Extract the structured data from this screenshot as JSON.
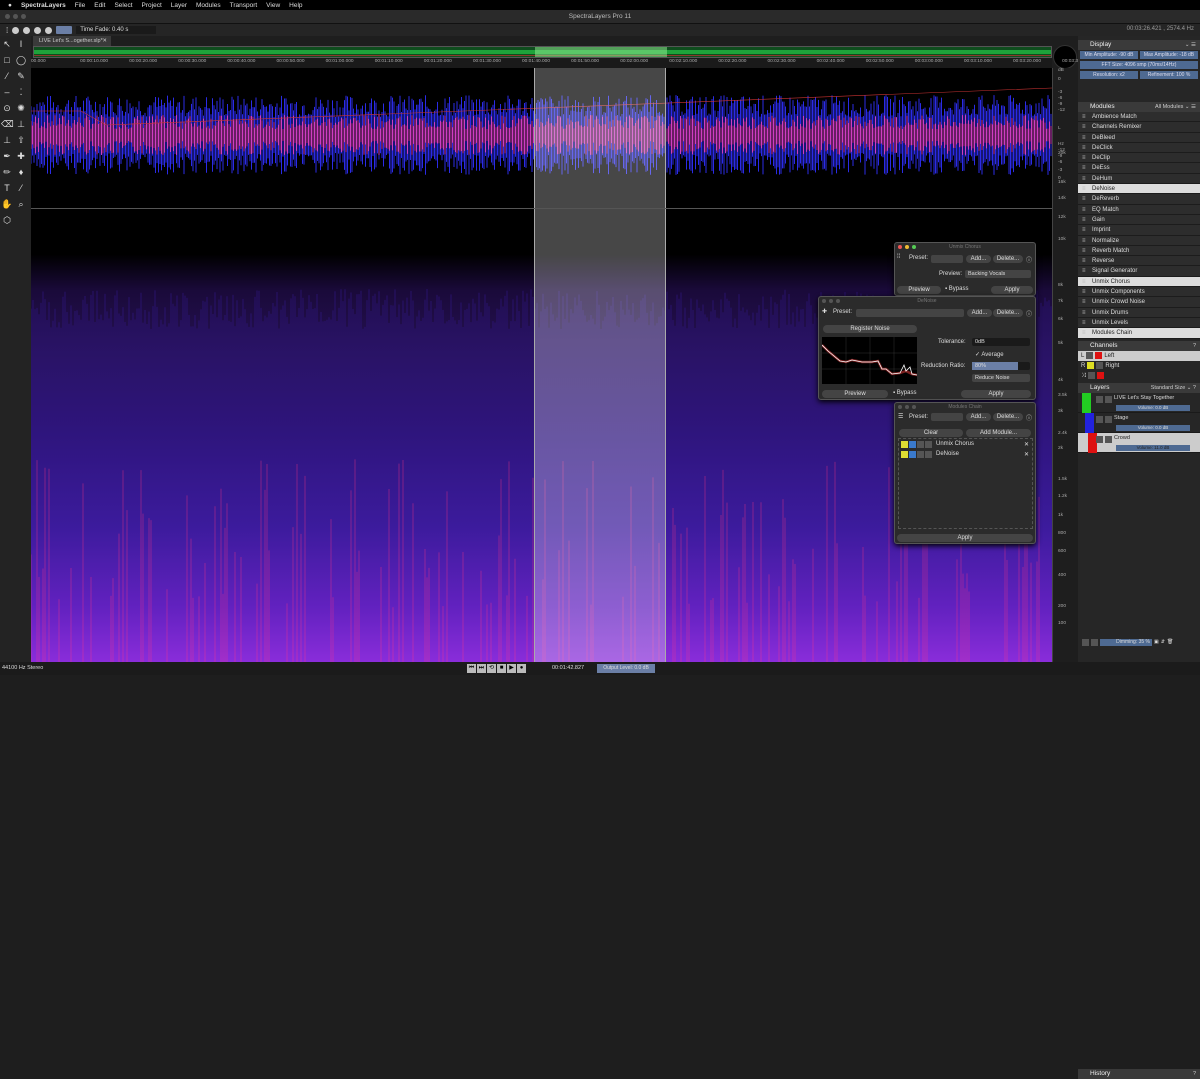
{
  "menubar": {
    "app": "SpectraLayers",
    "items": [
      "File",
      "Edit",
      "Select",
      "Project",
      "Layer",
      "Modules",
      "Transport",
      "View",
      "Help"
    ]
  },
  "window": {
    "title": "SpectraLayers Pro 11"
  },
  "toolbar": {
    "time_fade": "Time Fade: 0.40 s",
    "cursor_info": "00:03:26.421 , 2574.4 Hz"
  },
  "tab": {
    "label": "LIVE Let's S...ogether.slp*",
    "close": "✕"
  },
  "ruler": [
    "00.000",
    "00:00:10.000",
    "00:00:20.000",
    "00:00:30.000",
    "00:00:40.000",
    "00:00:50.000",
    "00:01:00.000",
    "00:01:10.000",
    "00:01:20.000",
    "00:01:30.000",
    "00:01:40.000",
    "00:01:50.000",
    "00:02:00.000",
    "00:02:10.000",
    "00:02:20.000",
    "00:02:30.000",
    "00:02:40.000",
    "00:02:50.000",
    "00:03:00.000",
    "00:03:10.000",
    "00:03:20.000",
    "00:03:30.000"
  ],
  "amp_axis": [
    "dB",
    "0",
    "-3",
    "-6",
    "-9",
    "-12",
    "L",
    "-12",
    "-9",
    "-6",
    "-3",
    "0"
  ],
  "freq_axis": [
    "Hz",
    "20k",
    "16k",
    "14k",
    "12k",
    "10k",
    "8k",
    "7k",
    "6k",
    "5k",
    "4k",
    "3.5k",
    "3k",
    "2.4k",
    "2k",
    "1.5k",
    "1.2k",
    "1k",
    "800",
    "600",
    "400",
    "200",
    "100"
  ],
  "selection": {
    "start": "00:01:42.827"
  },
  "display": {
    "title": "Display",
    "min_amp": "Min Amplitude: -90 dB",
    "max_amp": "Max Amplitude: -18 dB",
    "fft": "FFT Size: 4096 smp (70ms/14Hz)",
    "resolution": "Resolution: x2",
    "refinement": "Refinement: 100 %"
  },
  "modules": {
    "title": "Modules",
    "filter": "All Modules",
    "items": [
      "Ambience Match",
      "Channels Remixer",
      "DeBleed",
      "DeClick",
      "DeClip",
      "DeEss",
      "DeHum",
      "DeNoise",
      "DeReverb",
      "EQ Match",
      "Gain",
      "Imprint",
      "Normalize",
      "Reverb Match",
      "Reverse",
      "Signal Generator",
      "Unmix Chorus",
      "Unmix Components",
      "Unmix Crowd Noise",
      "Unmix Drums",
      "Unmix Levels"
    ],
    "highlighted": [
      "DeNoise",
      "Unmix Chorus"
    ],
    "chain": "Modules Chain"
  },
  "channels": {
    "title": "Channels",
    "items": [
      {
        "tag": "L",
        "name": "Left"
      },
      {
        "tag": "R",
        "name": "Right"
      }
    ]
  },
  "layers": {
    "title": "Layers",
    "size": "Standard Size",
    "items": [
      {
        "name": "LIVE Let's Stay Together",
        "volume": "Volume: 0.0 dB",
        "color": "#22cc22"
      },
      {
        "name": "Stage",
        "volume": "Volume: 0.0 dB",
        "color": "#2222dd"
      },
      {
        "name": "Crowd",
        "volume": "Volume: 11.0 dB",
        "color": "#dd1111"
      }
    ],
    "dimming": "Dimming: 35 %"
  },
  "history": {
    "title": "History"
  },
  "unmix_chorus": {
    "title": "Unmix Chorus",
    "preset": "Preset:",
    "add": "Add...",
    "delete": "Delete...",
    "preview_label": "Preview:",
    "preview_value": "Backing Vocals",
    "preview_btn": "Preview",
    "bypass": "Bypass",
    "apply": "Apply"
  },
  "denoise": {
    "title": "DeNoise",
    "preset": "Preset:",
    "add": "Add...",
    "delete": "Delete...",
    "register": "Register Noise",
    "tolerance_label": "Tolerance:",
    "tolerance": "0dB",
    "average": "✓ Average",
    "ratio_label": "Reduction Ratio:",
    "ratio": "80%",
    "ratio_fraction": 0.8,
    "mode": "Reduce Noise",
    "preview_btn": "Preview",
    "bypass": "Bypass",
    "apply": "Apply"
  },
  "chain": {
    "title": "Modules Chain",
    "preset": "Preset:",
    "add": "Add...",
    "delete": "Delete...",
    "clear": "Clear",
    "add_module": "Add Module...",
    "items": [
      "Unmix Chorus",
      "DeNoise"
    ],
    "apply": "Apply"
  },
  "status": {
    "format": "44100 Hz Stereo",
    "time": "00:01:42.827",
    "output_level": "Output Level: 0.0 dB"
  },
  "colors": {
    "accent": "#4e6a92",
    "overview": "#1ea33a",
    "wave_blue": "#3030ff",
    "wave_pink": "#e040c0"
  }
}
